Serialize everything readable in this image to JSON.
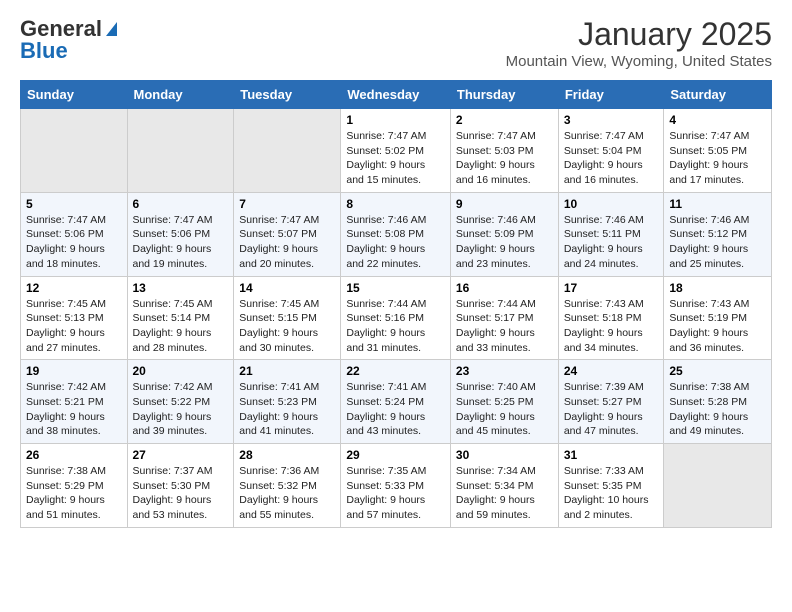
{
  "logo": {
    "general": "General",
    "blue": "Blue"
  },
  "header": {
    "month": "January 2025",
    "location": "Mountain View, Wyoming, United States"
  },
  "weekdays": [
    "Sunday",
    "Monday",
    "Tuesday",
    "Wednesday",
    "Thursday",
    "Friday",
    "Saturday"
  ],
  "weeks": [
    [
      {
        "day": "",
        "sunrise": "",
        "sunset": "",
        "daylight": ""
      },
      {
        "day": "",
        "sunrise": "",
        "sunset": "",
        "daylight": ""
      },
      {
        "day": "",
        "sunrise": "",
        "sunset": "",
        "daylight": ""
      },
      {
        "day": "1",
        "sunrise": "Sunrise: 7:47 AM",
        "sunset": "Sunset: 5:02 PM",
        "daylight": "Daylight: 9 hours and 15 minutes."
      },
      {
        "day": "2",
        "sunrise": "Sunrise: 7:47 AM",
        "sunset": "Sunset: 5:03 PM",
        "daylight": "Daylight: 9 hours and 16 minutes."
      },
      {
        "day": "3",
        "sunrise": "Sunrise: 7:47 AM",
        "sunset": "Sunset: 5:04 PM",
        "daylight": "Daylight: 9 hours and 16 minutes."
      },
      {
        "day": "4",
        "sunrise": "Sunrise: 7:47 AM",
        "sunset": "Sunset: 5:05 PM",
        "daylight": "Daylight: 9 hours and 17 minutes."
      }
    ],
    [
      {
        "day": "5",
        "sunrise": "Sunrise: 7:47 AM",
        "sunset": "Sunset: 5:06 PM",
        "daylight": "Daylight: 9 hours and 18 minutes."
      },
      {
        "day": "6",
        "sunrise": "Sunrise: 7:47 AM",
        "sunset": "Sunset: 5:06 PM",
        "daylight": "Daylight: 9 hours and 19 minutes."
      },
      {
        "day": "7",
        "sunrise": "Sunrise: 7:47 AM",
        "sunset": "Sunset: 5:07 PM",
        "daylight": "Daylight: 9 hours and 20 minutes."
      },
      {
        "day": "8",
        "sunrise": "Sunrise: 7:46 AM",
        "sunset": "Sunset: 5:08 PM",
        "daylight": "Daylight: 9 hours and 22 minutes."
      },
      {
        "day": "9",
        "sunrise": "Sunrise: 7:46 AM",
        "sunset": "Sunset: 5:09 PM",
        "daylight": "Daylight: 9 hours and 23 minutes."
      },
      {
        "day": "10",
        "sunrise": "Sunrise: 7:46 AM",
        "sunset": "Sunset: 5:11 PM",
        "daylight": "Daylight: 9 hours and 24 minutes."
      },
      {
        "day": "11",
        "sunrise": "Sunrise: 7:46 AM",
        "sunset": "Sunset: 5:12 PM",
        "daylight": "Daylight: 9 hours and 25 minutes."
      }
    ],
    [
      {
        "day": "12",
        "sunrise": "Sunrise: 7:45 AM",
        "sunset": "Sunset: 5:13 PM",
        "daylight": "Daylight: 9 hours and 27 minutes."
      },
      {
        "day": "13",
        "sunrise": "Sunrise: 7:45 AM",
        "sunset": "Sunset: 5:14 PM",
        "daylight": "Daylight: 9 hours and 28 minutes."
      },
      {
        "day": "14",
        "sunrise": "Sunrise: 7:45 AM",
        "sunset": "Sunset: 5:15 PM",
        "daylight": "Daylight: 9 hours and 30 minutes."
      },
      {
        "day": "15",
        "sunrise": "Sunrise: 7:44 AM",
        "sunset": "Sunset: 5:16 PM",
        "daylight": "Daylight: 9 hours and 31 minutes."
      },
      {
        "day": "16",
        "sunrise": "Sunrise: 7:44 AM",
        "sunset": "Sunset: 5:17 PM",
        "daylight": "Daylight: 9 hours and 33 minutes."
      },
      {
        "day": "17",
        "sunrise": "Sunrise: 7:43 AM",
        "sunset": "Sunset: 5:18 PM",
        "daylight": "Daylight: 9 hours and 34 minutes."
      },
      {
        "day": "18",
        "sunrise": "Sunrise: 7:43 AM",
        "sunset": "Sunset: 5:19 PM",
        "daylight": "Daylight: 9 hours and 36 minutes."
      }
    ],
    [
      {
        "day": "19",
        "sunrise": "Sunrise: 7:42 AM",
        "sunset": "Sunset: 5:21 PM",
        "daylight": "Daylight: 9 hours and 38 minutes."
      },
      {
        "day": "20",
        "sunrise": "Sunrise: 7:42 AM",
        "sunset": "Sunset: 5:22 PM",
        "daylight": "Daylight: 9 hours and 39 minutes."
      },
      {
        "day": "21",
        "sunrise": "Sunrise: 7:41 AM",
        "sunset": "Sunset: 5:23 PM",
        "daylight": "Daylight: 9 hours and 41 minutes."
      },
      {
        "day": "22",
        "sunrise": "Sunrise: 7:41 AM",
        "sunset": "Sunset: 5:24 PM",
        "daylight": "Daylight: 9 hours and 43 minutes."
      },
      {
        "day": "23",
        "sunrise": "Sunrise: 7:40 AM",
        "sunset": "Sunset: 5:25 PM",
        "daylight": "Daylight: 9 hours and 45 minutes."
      },
      {
        "day": "24",
        "sunrise": "Sunrise: 7:39 AM",
        "sunset": "Sunset: 5:27 PM",
        "daylight": "Daylight: 9 hours and 47 minutes."
      },
      {
        "day": "25",
        "sunrise": "Sunrise: 7:38 AM",
        "sunset": "Sunset: 5:28 PM",
        "daylight": "Daylight: 9 hours and 49 minutes."
      }
    ],
    [
      {
        "day": "26",
        "sunrise": "Sunrise: 7:38 AM",
        "sunset": "Sunset: 5:29 PM",
        "daylight": "Daylight: 9 hours and 51 minutes."
      },
      {
        "day": "27",
        "sunrise": "Sunrise: 7:37 AM",
        "sunset": "Sunset: 5:30 PM",
        "daylight": "Daylight: 9 hours and 53 minutes."
      },
      {
        "day": "28",
        "sunrise": "Sunrise: 7:36 AM",
        "sunset": "Sunset: 5:32 PM",
        "daylight": "Daylight: 9 hours and 55 minutes."
      },
      {
        "day": "29",
        "sunrise": "Sunrise: 7:35 AM",
        "sunset": "Sunset: 5:33 PM",
        "daylight": "Daylight: 9 hours and 57 minutes."
      },
      {
        "day": "30",
        "sunrise": "Sunrise: 7:34 AM",
        "sunset": "Sunset: 5:34 PM",
        "daylight": "Daylight: 9 hours and 59 minutes."
      },
      {
        "day": "31",
        "sunrise": "Sunrise: 7:33 AM",
        "sunset": "Sunset: 5:35 PM",
        "daylight": "Daylight: 10 hours and 2 minutes."
      },
      {
        "day": "",
        "sunrise": "",
        "sunset": "",
        "daylight": ""
      }
    ]
  ]
}
